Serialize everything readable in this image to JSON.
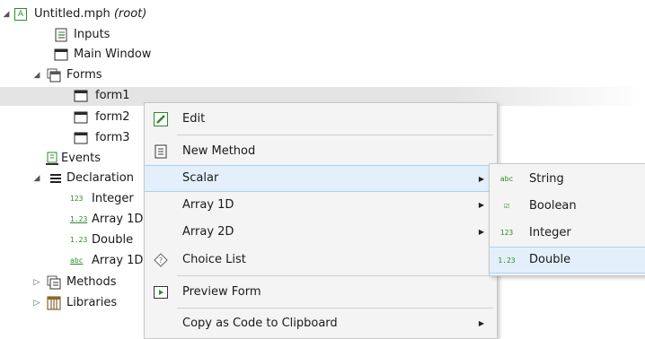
{
  "tree": {
    "root": {
      "label": "Untitled.mph",
      "suffix": "(root)",
      "badge": "A"
    },
    "items": [
      {
        "label": "Inputs"
      },
      {
        "label": "Main Window"
      },
      {
        "label": "Forms"
      },
      {
        "label": "form1"
      },
      {
        "label": "form2"
      },
      {
        "label": "form3"
      },
      {
        "label": "Events"
      },
      {
        "label": "Declaration"
      },
      {
        "label": "Integer"
      },
      {
        "label": "Array 1D"
      },
      {
        "label": "Double"
      },
      {
        "label": "Array 1D"
      },
      {
        "label": "Methods"
      },
      {
        "label": "Libraries"
      }
    ],
    "type_badges": {
      "integer": "123",
      "array_double": "1.23",
      "double": "1.23",
      "array_string": "abc"
    }
  },
  "context_menu": {
    "items": [
      {
        "label": "Edit",
        "icon": "pencil-icon"
      },
      {
        "label": "New Method",
        "icon": "method-icon"
      },
      {
        "label": "Scalar",
        "has_submenu": true,
        "highlighted": true
      },
      {
        "label": "Array 1D",
        "has_submenu": true
      },
      {
        "label": "Array 2D",
        "has_submenu": true
      },
      {
        "label": "Choice List",
        "icon": "choice-list-icon"
      },
      {
        "label": "Preview Form",
        "icon": "preview-icon"
      },
      {
        "label": "Copy as Code to Clipboard",
        "has_submenu": true
      }
    ],
    "submenu_arrow": "▶"
  },
  "submenu": {
    "items": [
      {
        "label": "String",
        "icon_text": "abc"
      },
      {
        "label": "Boolean",
        "icon_text": "☑"
      },
      {
        "label": "Integer",
        "icon_text": "123"
      },
      {
        "label": "Double",
        "icon_text": "1.23",
        "highlighted": true
      }
    ]
  },
  "colors": {
    "highlight_bg": "#e3f0fb",
    "highlight_border": "#a9d1f2",
    "selected_row": "#e4e4e4"
  }
}
